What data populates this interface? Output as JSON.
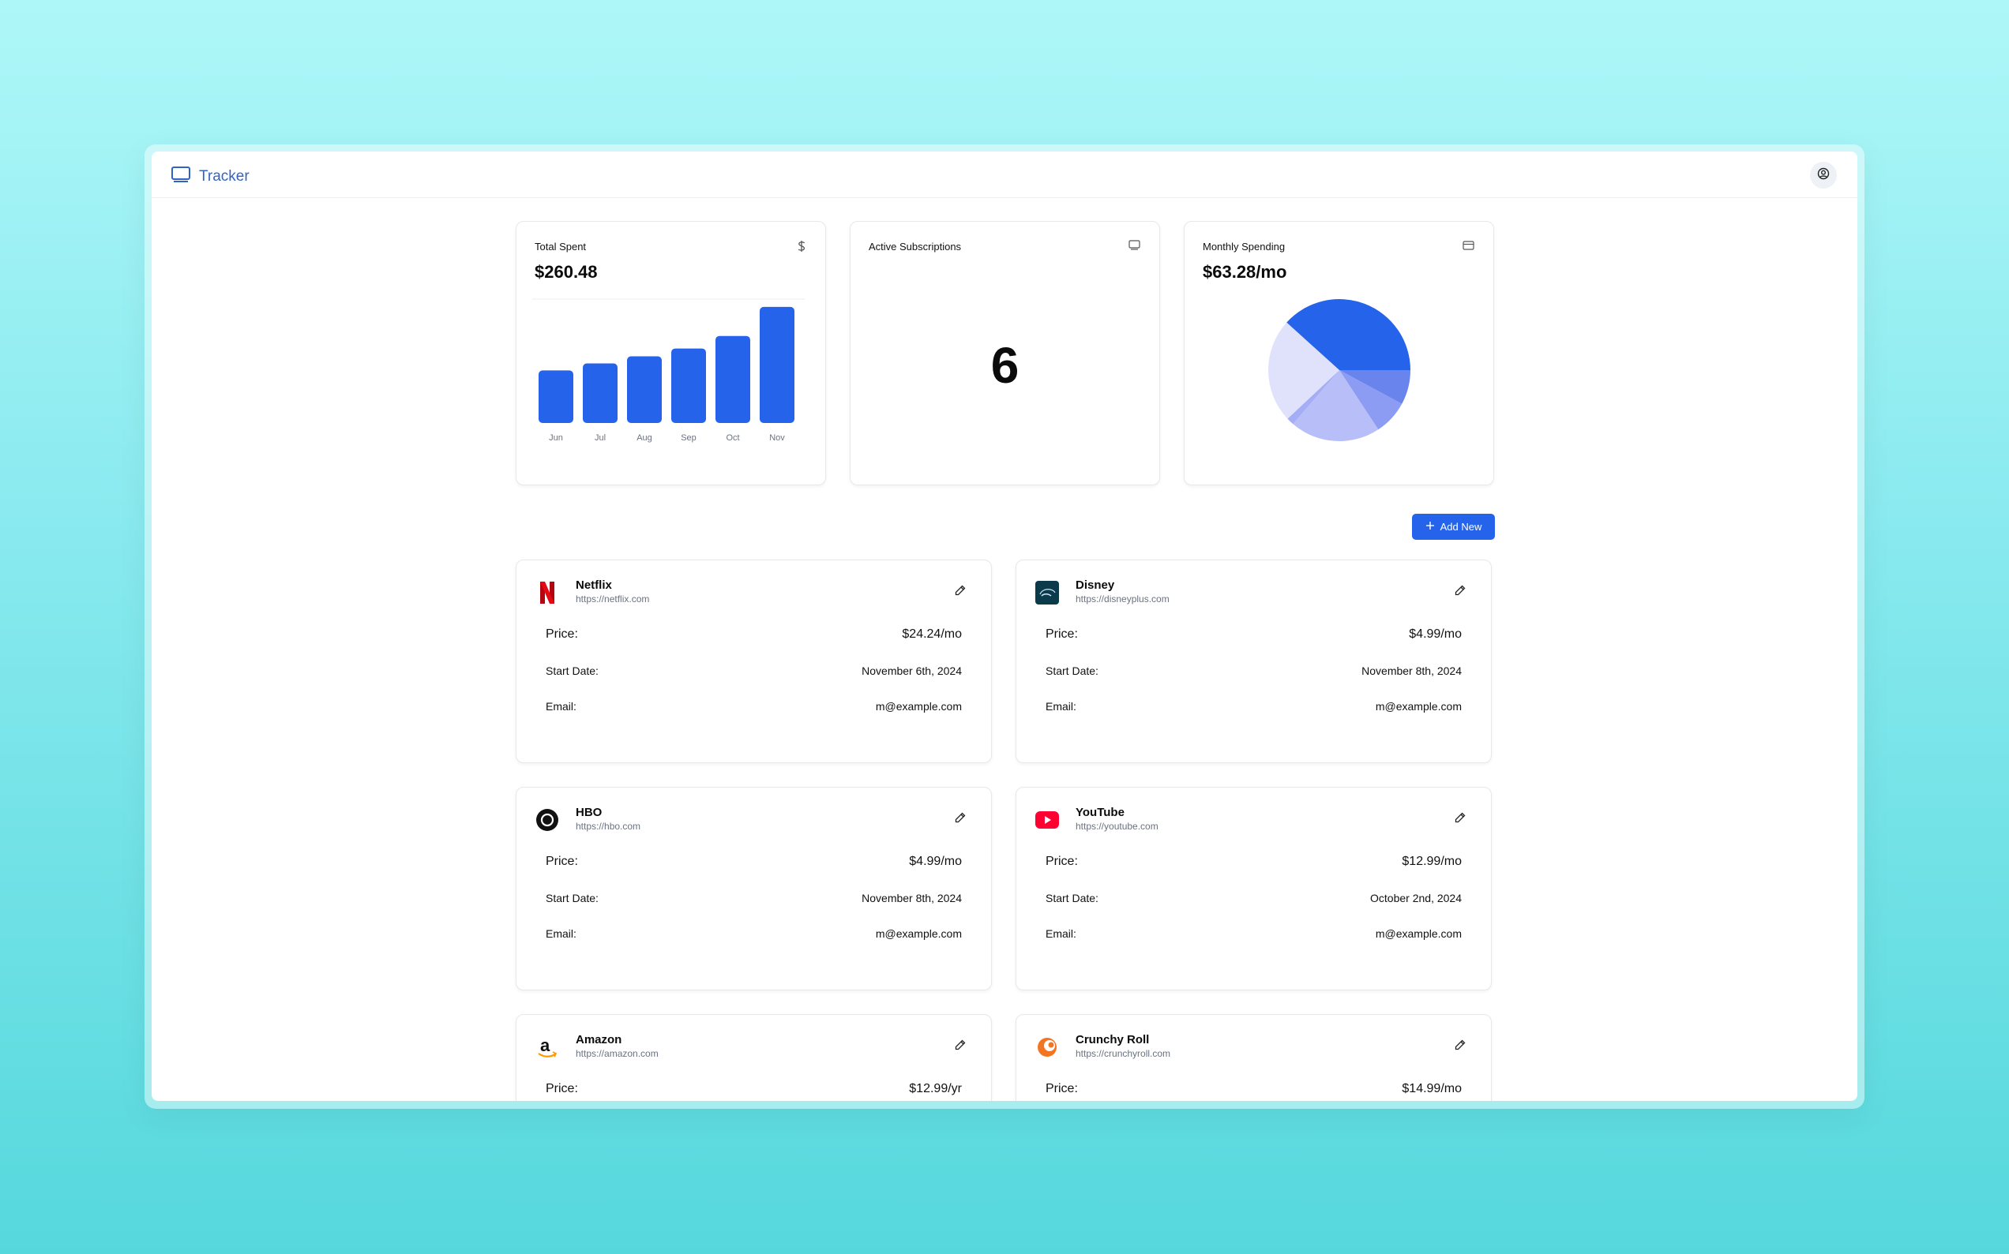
{
  "app": {
    "title": "Tracker"
  },
  "stats": {
    "total_spent": {
      "label": "Total Spent",
      "value": "$260.48",
      "icon": "dollar-icon"
    },
    "active": {
      "label": "Active Subscriptions",
      "value": "6",
      "icon": "monitor-icon"
    },
    "monthly": {
      "label": "Monthly Spending",
      "value": "$63.28/mo",
      "icon": "credit-card-icon"
    }
  },
  "chart_data": [
    {
      "type": "bar",
      "categories": [
        "Jun",
        "Jul",
        "Aug",
        "Sep",
        "Oct",
        "Nov"
      ],
      "values": [
        67,
        76,
        85,
        95,
        111,
        148
      ],
      "ylim": [
        0,
        160
      ],
      "grid": true,
      "colors": [
        "#2563eb"
      ]
    },
    {
      "type": "pie",
      "slices": [
        {
          "value": 24.24,
          "color": "#2563eb"
        },
        {
          "value": 4.99,
          "color": "#6a84ee"
        },
        {
          "value": 4.99,
          "color": "#8b9cf2"
        },
        {
          "value": 12.99,
          "color": "#b8bff8"
        },
        {
          "value": 1.08,
          "color": "#a4adf5"
        },
        {
          "value": 14.99,
          "color": "#e0e2fc"
        }
      ]
    }
  ],
  "actions": {
    "add_new": "Add New"
  },
  "labels": {
    "price": "Price:",
    "start_date": "Start Date:",
    "email": "Email:"
  },
  "subscriptions": [
    {
      "name": "Netflix",
      "url": "https://netflix.com",
      "price": "$24.24/mo",
      "start_date": "November 6th, 2024",
      "email": "m@example.com",
      "icon": "netflix-logo-icon"
    },
    {
      "name": "Disney",
      "url": "https://disneyplus.com",
      "price": "$4.99/mo",
      "start_date": "November 8th, 2024",
      "email": "m@example.com",
      "icon": "disney-logo-icon"
    },
    {
      "name": "HBO",
      "url": "https://hbo.com",
      "price": "$4.99/mo",
      "start_date": "November 8th, 2024",
      "email": "m@example.com",
      "icon": "hbo-logo-icon"
    },
    {
      "name": "YouTube",
      "url": "https://youtube.com",
      "price": "$12.99/mo",
      "start_date": "October 2nd, 2024",
      "email": "m@example.com",
      "icon": "youtube-logo-icon"
    },
    {
      "name": "Amazon",
      "url": "https://amazon.com",
      "price": "$12.99/yr",
      "start_date": "",
      "email": "",
      "icon": "amazon-logo-icon"
    },
    {
      "name": "Crunchy Roll",
      "url": "https://crunchyroll.com",
      "price": "$14.99/mo",
      "start_date": "",
      "email": "",
      "icon": "crunchyroll-logo-icon"
    }
  ]
}
